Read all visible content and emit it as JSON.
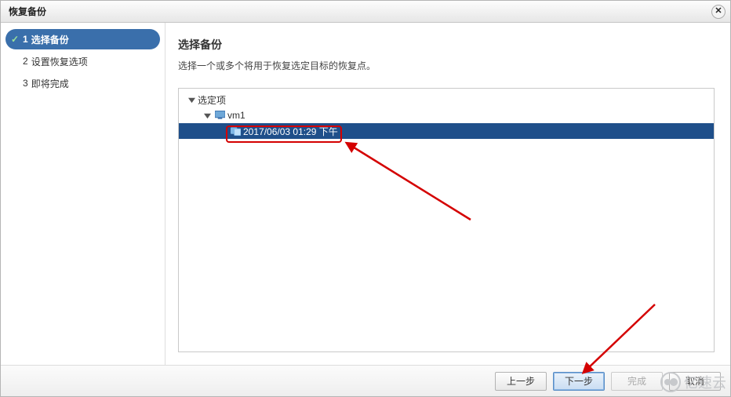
{
  "dialog": {
    "title": "恢复备份"
  },
  "steps": [
    {
      "num": "1",
      "label": "选择备份",
      "checked": true,
      "active": true
    },
    {
      "num": "2",
      "label": "设置恢复选项",
      "checked": false,
      "active": false
    },
    {
      "num": "3",
      "label": "即将完成",
      "checked": false,
      "active": false
    }
  ],
  "section": {
    "title": "选择备份",
    "description": "选择一个或多个将用于恢复选定目标的恢复点。"
  },
  "tree": {
    "root_label": "选定项",
    "vm_label": "vm1",
    "backup_label": "2017/06/03 01:29 下午"
  },
  "buttons": {
    "back": "上一步",
    "next": "下一步",
    "finish": "完成",
    "cancel": "取消"
  },
  "watermark_text": "亿速云"
}
